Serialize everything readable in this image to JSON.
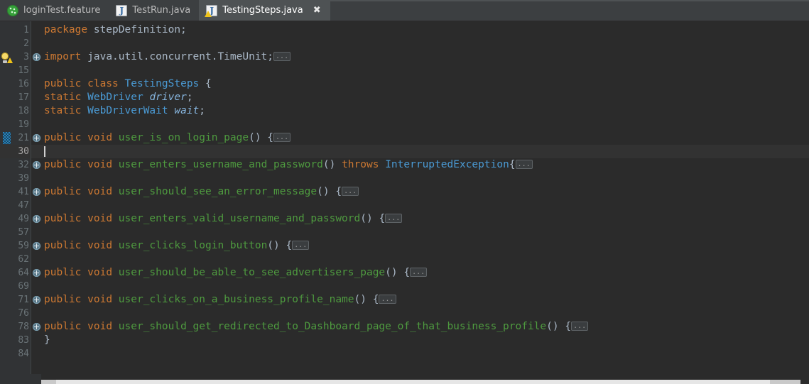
{
  "window": {
    "editor_background": "#2b2b2b",
    "gutter_background": "#313335",
    "tabbar_background": "#3c3f41",
    "active_tab_background": "#4e5254",
    "current_line_background": "#323232"
  },
  "tabs": [
    {
      "label": "loginTest.feature",
      "icon": "cucumber-feature-icon",
      "active": false,
      "closable": false
    },
    {
      "label": "TestRun.java",
      "icon": "java-file-icon",
      "active": false,
      "closable": false
    },
    {
      "label": "TestingSteps.java",
      "icon": "java-file-warning-icon",
      "active": true,
      "closable": true,
      "close_glyph": "✖"
    }
  ],
  "editor": {
    "fold_placeholder": "...",
    "syntax_colors": {
      "keyword": "#cc7832",
      "class_name": "#4a9ad4",
      "method_name": "#4e9a3f",
      "field_name": "#86b4dd",
      "plain": "#a9b7c6",
      "line_number": "#6a7377",
      "current_line_number": "#a4a3a3"
    },
    "lines": [
      {
        "num": "1",
        "indent": 0,
        "tokens": [
          {
            "t": "package",
            "c": "kw"
          },
          {
            "t": " ",
            "c": "plain"
          },
          {
            "t": "stepDefinition;",
            "c": "plain"
          }
        ],
        "fold": false,
        "marker": null,
        "current": false
      },
      {
        "num": "2",
        "indent": 0,
        "tokens": [],
        "fold": false,
        "marker": null,
        "current": false
      },
      {
        "num": "3",
        "indent": 0,
        "tokens": [
          {
            "t": "import",
            "c": "kw"
          },
          {
            "t": " ",
            "c": "plain"
          },
          {
            "t": "java.util.concurrent.TimeUnit;",
            "c": "plain"
          }
        ],
        "fold": true,
        "folded_code": true,
        "marker": "bulb",
        "current": false
      },
      {
        "num": "15",
        "indent": 0,
        "tokens": [],
        "fold": false,
        "marker": null,
        "current": false
      },
      {
        "num": "16",
        "indent": 0,
        "tokens": [
          {
            "t": "public",
            "c": "kw"
          },
          {
            "t": " ",
            "c": "plain"
          },
          {
            "t": "class",
            "c": "kw"
          },
          {
            "t": " ",
            "c": "plain"
          },
          {
            "t": "TestingSteps",
            "c": "cls"
          },
          {
            "t": " {",
            "c": "plain"
          }
        ],
        "fold": false,
        "marker": null,
        "current": false
      },
      {
        "num": "17",
        "indent": 1,
        "tokens": [
          {
            "t": "static",
            "c": "kw"
          },
          {
            "t": " ",
            "c": "plain"
          },
          {
            "t": "WebDriver",
            "c": "cls"
          },
          {
            "t": " ",
            "c": "plain"
          },
          {
            "t": "driver",
            "c": "fld"
          },
          {
            "t": ";",
            "c": "plain"
          }
        ],
        "fold": false,
        "marker": null,
        "current": false
      },
      {
        "num": "18",
        "indent": 1,
        "tokens": [
          {
            "t": "static",
            "c": "kw"
          },
          {
            "t": " ",
            "c": "plain"
          },
          {
            "t": "WebDriverWait",
            "c": "cls"
          },
          {
            "t": " ",
            "c": "plain"
          },
          {
            "t": "wait",
            "c": "fld"
          },
          {
            "t": ";",
            "c": "plain"
          }
        ],
        "fold": false,
        "marker": null,
        "current": false
      },
      {
        "num": "19",
        "indent": 0,
        "tokens": [],
        "fold": false,
        "marker": null,
        "current": false
      },
      {
        "num": "21",
        "indent": 1,
        "tokens": [
          {
            "t": "public",
            "c": "kw"
          },
          {
            "t": " ",
            "c": "plain"
          },
          {
            "t": "void",
            "c": "kw"
          },
          {
            "t": " ",
            "c": "plain"
          },
          {
            "t": "user_is_on_login_page",
            "c": "mtd"
          },
          {
            "t": "() {",
            "c": "plain"
          }
        ],
        "fold": true,
        "folded_code": true,
        "marker": "vcs",
        "current": false
      },
      {
        "num": "30",
        "indent": 0,
        "tokens": [],
        "fold": false,
        "marker": null,
        "current": true,
        "caret": true
      },
      {
        "num": "32",
        "indent": 1,
        "tokens": [
          {
            "t": "public",
            "c": "kw"
          },
          {
            "t": " ",
            "c": "plain"
          },
          {
            "t": "void",
            "c": "kw"
          },
          {
            "t": " ",
            "c": "plain"
          },
          {
            "t": "user_enters_username_and_password",
            "c": "mtd"
          },
          {
            "t": "() ",
            "c": "plain"
          },
          {
            "t": "throws",
            "c": "kw"
          },
          {
            "t": " ",
            "c": "plain"
          },
          {
            "t": "InterruptedException",
            "c": "cls"
          },
          {
            "t": "{",
            "c": "plain"
          }
        ],
        "fold": true,
        "folded_code": true,
        "marker": null,
        "current": false
      },
      {
        "num": "39",
        "indent": 0,
        "tokens": [],
        "fold": false,
        "marker": null,
        "current": false
      },
      {
        "num": "41",
        "indent": 1,
        "tokens": [
          {
            "t": "public",
            "c": "kw"
          },
          {
            "t": " ",
            "c": "plain"
          },
          {
            "t": "void",
            "c": "kw"
          },
          {
            "t": " ",
            "c": "plain"
          },
          {
            "t": "user_should_see_an_error_message",
            "c": "mtd"
          },
          {
            "t": "() {",
            "c": "plain"
          }
        ],
        "fold": true,
        "folded_code": true,
        "marker": null,
        "current": false
      },
      {
        "num": "47",
        "indent": 0,
        "tokens": [],
        "fold": false,
        "marker": null,
        "current": false
      },
      {
        "num": "49",
        "indent": 1,
        "tokens": [
          {
            "t": "public",
            "c": "kw"
          },
          {
            "t": " ",
            "c": "plain"
          },
          {
            "t": "void",
            "c": "kw"
          },
          {
            "t": " ",
            "c": "plain"
          },
          {
            "t": "user_enters_valid_username_and_password",
            "c": "mtd"
          },
          {
            "t": "() {",
            "c": "plain"
          }
        ],
        "fold": true,
        "folded_code": true,
        "marker": null,
        "current": false
      },
      {
        "num": "57",
        "indent": 0,
        "tokens": [],
        "fold": false,
        "marker": null,
        "current": false
      },
      {
        "num": "59",
        "indent": 1,
        "tokens": [
          {
            "t": "public",
            "c": "kw"
          },
          {
            "t": " ",
            "c": "plain"
          },
          {
            "t": "void",
            "c": "kw"
          },
          {
            "t": " ",
            "c": "plain"
          },
          {
            "t": "user_clicks_login_button",
            "c": "mtd"
          },
          {
            "t": "() {",
            "c": "plain"
          }
        ],
        "fold": true,
        "folded_code": true,
        "marker": null,
        "current": false
      },
      {
        "num": "62",
        "indent": 0,
        "tokens": [],
        "fold": false,
        "marker": null,
        "current": false
      },
      {
        "num": "64",
        "indent": 1,
        "tokens": [
          {
            "t": "public",
            "c": "kw"
          },
          {
            "t": " ",
            "c": "plain"
          },
          {
            "t": "void",
            "c": "kw"
          },
          {
            "t": " ",
            "c": "plain"
          },
          {
            "t": "user_should_be_able_to_see_advertisers_page",
            "c": "mtd"
          },
          {
            "t": "() {",
            "c": "plain"
          }
        ],
        "fold": true,
        "folded_code": true,
        "marker": null,
        "current": false
      },
      {
        "num": "69",
        "indent": 0,
        "tokens": [],
        "fold": false,
        "marker": null,
        "current": false
      },
      {
        "num": "71",
        "indent": 1,
        "tokens": [
          {
            "t": "public",
            "c": "kw"
          },
          {
            "t": " ",
            "c": "plain"
          },
          {
            "t": "void",
            "c": "kw"
          },
          {
            "t": " ",
            "c": "plain"
          },
          {
            "t": "user_clicks_on_a_business_profile_name",
            "c": "mtd"
          },
          {
            "t": "() {",
            "c": "plain"
          }
        ],
        "fold": true,
        "folded_code": true,
        "marker": null,
        "current": false
      },
      {
        "num": "76",
        "indent": 0,
        "tokens": [],
        "fold": false,
        "marker": null,
        "current": false
      },
      {
        "num": "78",
        "indent": 1,
        "tokens": [
          {
            "t": "public",
            "c": "kw"
          },
          {
            "t": " ",
            "c": "plain"
          },
          {
            "t": "void",
            "c": "kw"
          },
          {
            "t": " ",
            "c": "plain"
          },
          {
            "t": "user_should_get_redirected_to_Dashboard_page_of_that_business_profile",
            "c": "mtd"
          },
          {
            "t": "() {",
            "c": "plain"
          }
        ],
        "fold": true,
        "folded_code": true,
        "marker": null,
        "current": false
      },
      {
        "num": "83",
        "indent": 0,
        "tokens": [
          {
            "t": "}",
            "c": "plain"
          }
        ],
        "fold": false,
        "marker": null,
        "current": false
      },
      {
        "num": "84",
        "indent": 0,
        "tokens": [],
        "fold": false,
        "marker": null,
        "current": false
      }
    ]
  },
  "scrollbar": {
    "orientation": "horizontal",
    "position": "bottom"
  }
}
